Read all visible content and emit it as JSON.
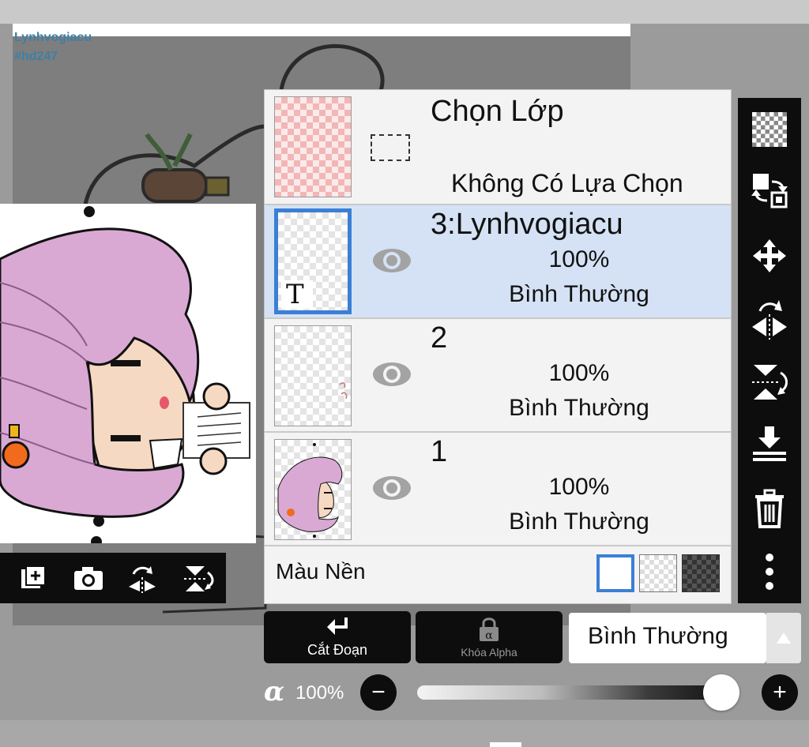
{
  "watermark": {
    "line1": "Lynhvogiacu",
    "line2": "#hd247"
  },
  "selection": {
    "title": "Chọn Lớp",
    "status": "Không Có Lựa Chọn"
  },
  "layers": [
    {
      "name": "3:Lynhvogiacu",
      "opacity": "100%",
      "blend": "Bình Thường",
      "selected": true,
      "type_marker": "T"
    },
    {
      "name": "2",
      "opacity": "100%",
      "blend": "Bình Thường",
      "selected": false
    },
    {
      "name": "1",
      "opacity": "100%",
      "blend": "Bình Thường",
      "selected": false
    }
  ],
  "background_color": {
    "label": "Màu Nền",
    "options": [
      "white",
      "checker",
      "dark-checker"
    ],
    "selected": "white"
  },
  "buttons": {
    "clip": "Cắt Đoạn",
    "alpha_lock": "Khóa Alpha"
  },
  "blend_mode": {
    "value": "Bình Thường"
  },
  "opacity": {
    "symbol": "α",
    "value": "100%",
    "fraction": 1.0,
    "minus": "−",
    "plus": "+"
  },
  "icons": {
    "canvas_toolbar": [
      "add-layer-icon",
      "camera-icon",
      "flip-horizontal-icon",
      "flip-vertical-icon"
    ],
    "right_toolbar": [
      "new-layer-checker-icon",
      "swap-layer-icon",
      "move-icon",
      "flip-horizontal-icon",
      "flip-vertical-icon",
      "merge-down-icon",
      "trash-icon",
      "more-vert-icon"
    ]
  },
  "colors": {
    "selection_highlight": "#d5e2f5",
    "accent": "#3b7fd6",
    "toolbar": "#0d0d0d"
  }
}
